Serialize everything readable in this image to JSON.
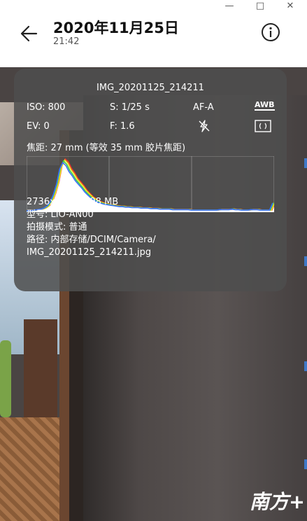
{
  "window": {
    "minimize": "—",
    "maximize": "□",
    "close": "✕"
  },
  "header": {
    "title": "2020年11月25日",
    "time": "21:42",
    "back_icon": "arrow-left-icon",
    "info_icon": "info-circle-icon"
  },
  "overlay": {
    "filename": "IMG_20201125_214211",
    "iso": "ISO: 800",
    "shutter": "S: 1/25 s",
    "focus_mode": "AF-A",
    "awb": "AWB",
    "ev": "EV: 0",
    "aperture": "F: 1.6",
    "flash_icon": "flash-off-icon",
    "metering_icon": "metering-icon",
    "focal_length": "焦距: 27 mm (等效 35 mm 胶片焦距)",
    "resolution": "2736x3648  1.98 MB",
    "model": "型号: LIO-AN00",
    "mode": "拍摄模式: 普通",
    "path_label": "路径: 内部存储/DCIM/Camera/",
    "path_file": "IMG_20201125_214211.jpg",
    "histogram": {
      "levels": [
        0.02,
        0.03,
        0.03,
        0.04,
        0.05,
        0.06,
        0.08,
        0.12,
        0.2,
        0.35,
        0.55,
        0.85,
        0.98,
        0.92,
        0.8,
        0.72,
        0.62,
        0.55,
        0.48,
        0.4,
        0.34,
        0.28,
        0.24,
        0.2,
        0.18,
        0.16,
        0.15,
        0.14,
        0.13,
        0.12,
        0.11,
        0.11,
        0.1,
        0.1,
        0.09,
        0.09,
        0.09,
        0.08,
        0.08,
        0.08,
        0.07,
        0.07,
        0.07,
        0.06,
        0.06,
        0.06,
        0.06,
        0.05,
        0.05,
        0.05,
        0.05,
        0.05,
        0.05,
        0.04,
        0.04,
        0.04,
        0.04,
        0.04,
        0.04,
        0.04,
        0.04,
        0.04,
        0.05,
        0.05,
        0.05,
        0.05,
        0.06,
        0.05,
        0.05,
        0.04,
        0.04,
        0.04,
        0.05,
        0.05,
        0.05,
        0.04,
        0.04,
        0.04,
        0.04,
        0.18
      ],
      "colors": {
        "fill": "#ffffff",
        "red": "#e83030",
        "green": "#40d040",
        "blue": "#3a70ff",
        "yellow": "#f0e020"
      }
    }
  },
  "watermark": {
    "text": "南方+"
  }
}
